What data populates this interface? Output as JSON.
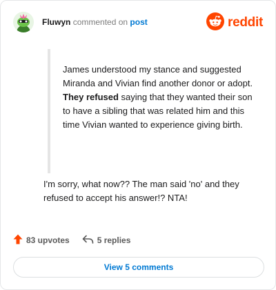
{
  "header": {
    "author": "Fluwyn",
    "action_text": "commented on",
    "post_link": "post",
    "logo_text": "reddit"
  },
  "quote": {
    "part1": "James understood my stance and suggested Miranda and Vivian find another donor or adopt. ",
    "bold": "They refused",
    "part2": " saying that they wanted their son to have a sibling that was related him and this time Vivian wanted to experience giving birth."
  },
  "comment": {
    "text": "I'm sorry, what now?? The man said 'no' and they refused to accept his answer!? NTA!"
  },
  "actions": {
    "upvotes": "83 upvotes",
    "replies": "5 replies"
  },
  "footer": {
    "view_comments": "View 5 comments"
  },
  "colors": {
    "accent": "#ff4500",
    "link": "#0079d3",
    "quote_border": "#e5e5e5"
  },
  "icons": {
    "avatar": "snoo-avatar-icon",
    "logo": "reddit-logo-icon",
    "upvote": "upvote-arrow-icon",
    "reply": "reply-arrow-icon"
  }
}
